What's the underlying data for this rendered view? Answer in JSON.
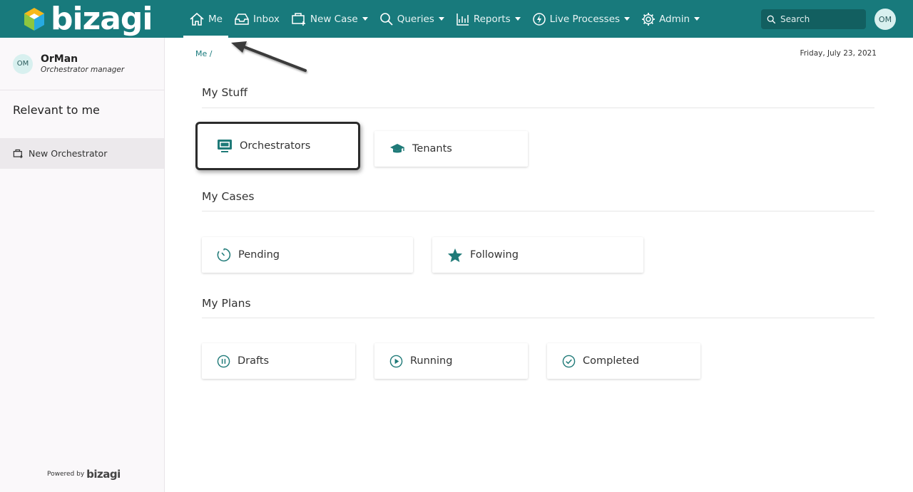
{
  "header": {
    "logo_text": "bizagi",
    "nav": [
      {
        "label": "Me",
        "icon": "home-icon",
        "active": true,
        "caret": false
      },
      {
        "label": "Inbox",
        "icon": "inbox-icon",
        "caret": false
      },
      {
        "label": "New Case",
        "icon": "new-case-icon",
        "caret": true
      },
      {
        "label": "Queries",
        "icon": "search-icon",
        "caret": true
      },
      {
        "label": "Reports",
        "icon": "chart-icon",
        "caret": true
      },
      {
        "label": "Live Processes",
        "icon": "lightning-icon",
        "caret": true
      },
      {
        "label": "Admin",
        "icon": "gear-icon",
        "caret": true
      }
    ],
    "search_placeholder": "Search",
    "avatar_initials": "OM"
  },
  "sidebar": {
    "user": {
      "initials": "OM",
      "name": "OrMan",
      "role": "Orchestrator manager"
    },
    "relevant_title": "Relevant to me",
    "items": [
      {
        "label": "New Orchestrator",
        "icon": "new-case-icon"
      }
    ],
    "powered_by": "Powered by",
    "powered_brand": "bizagi"
  },
  "main": {
    "breadcrumb": "Me /",
    "date": "Friday, July 23, 2021",
    "sections": [
      {
        "title": "My Stuff",
        "cards": [
          {
            "label": "Orchestrators",
            "icon": "monitor-icon"
          },
          {
            "label": "Tenants",
            "icon": "graduation-cap-icon"
          }
        ]
      },
      {
        "title": "My Cases",
        "cards": [
          {
            "label": "Pending",
            "icon": "clock-icon"
          },
          {
            "label": "Following",
            "icon": "star-icon"
          }
        ]
      },
      {
        "title": "My Plans",
        "cards": [
          {
            "label": "Drafts",
            "icon": "pause-circle-icon"
          },
          {
            "label": "Running",
            "icon": "play-circle-icon"
          },
          {
            "label": "Completed",
            "icon": "check-circle-icon"
          }
        ]
      }
    ]
  },
  "colors": {
    "brand": "#187a7c",
    "icon": "#1f7a78"
  }
}
